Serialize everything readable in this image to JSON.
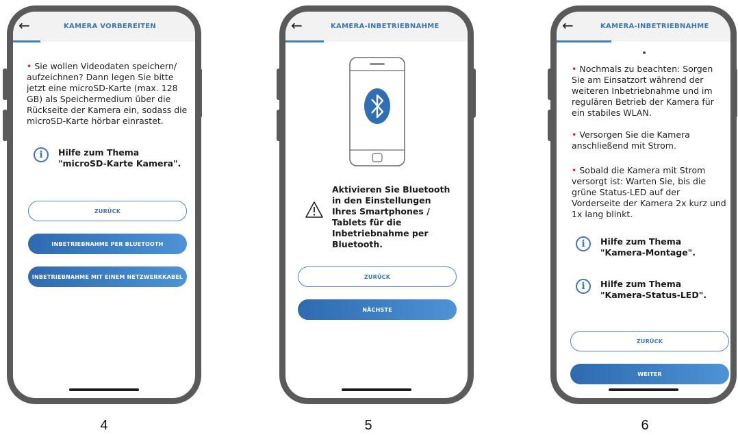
{
  "screens": [
    {
      "title": "KAMERA VORBEREITEN",
      "bullet": "Sie wollen Videodaten speichern/ aufzeichnen? Dann legen Sie bitte jetzt eine microSD-Karte (max. 128 GB) als Speichermedium über die Rückseite der Kamera ein, sodass die microSD-Karte hörbar einrastet.",
      "help": "Hilfe zum Thema \"microSD-Karte Kamera\".",
      "buttons": [
        "ZURÜCK",
        "INBETRIEBNAHME PER BLUETOOTH",
        "INBETRIEBNAHME MIT EINEM NETZWERKKABEL"
      ],
      "caption": "4"
    },
    {
      "title": "KAMERA-INBETRIEBNAHME",
      "warning": "Aktivieren Sie Bluetooth in den Einstellungen Ihres Smartphones / Tablets für die Inbetriebnahme per Bluetooth.",
      "buttons": [
        "ZURÜCK",
        "NÄCHSTE"
      ],
      "caption": "5"
    },
    {
      "title": "KAMERA-INBETRIEBNAHME",
      "bullets": [
        "Nochmals zu beachten: Sorgen Sie am Einsatzort während der weiteren Inbetriebnahme und im regulären Betrieb der Kamera für ein stabiles WLAN.",
        "Versorgen Sie die Kamera anschließend mit Strom.",
        "Sobald die Kamera mit Strom versorgt ist: Warten Sie, bis die grüne Status-LED auf der Vorderseite der Kamera 2x kurz und 1x lang blinkt."
      ],
      "help": [
        "Hilfe zum Thema \"Kamera-Montage\".",
        "Hilfe zum Thema \"Kamera-Status-LED\"."
      ],
      "buttons": [
        "ZURÜCK",
        "WEITER"
      ],
      "caption": "6"
    }
  ],
  "colors": {
    "accent": "#3a77b8",
    "bullet": "#d8202a",
    "frame": "#5a5a5a"
  },
  "icons": [
    "back-arrow-icon",
    "info-icon",
    "bluetooth-icon",
    "warning-icon",
    "smartphone-icon"
  ]
}
